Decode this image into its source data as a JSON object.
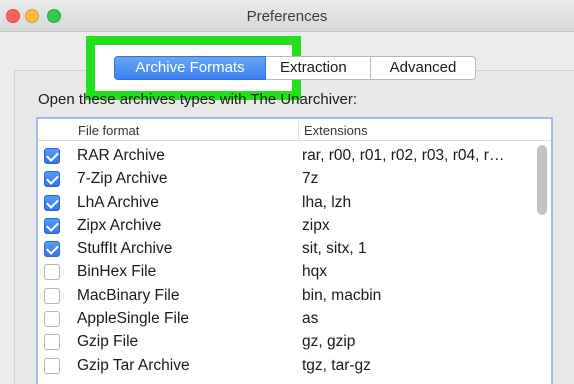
{
  "window": {
    "title": "Preferences"
  },
  "tabs": [
    {
      "label": "Archive Formats",
      "active": true
    },
    {
      "label": "Extraction",
      "active": false
    },
    {
      "label": "Advanced",
      "active": false
    }
  ],
  "instructions": "Open these archives types with The Unarchiver:",
  "table": {
    "headers": {
      "format": "File format",
      "extensions": "Extensions"
    },
    "rows": [
      {
        "checked": true,
        "format": "RAR Archive",
        "extensions": "rar, r00, r01, r02, r03, r04, r…"
      },
      {
        "checked": true,
        "format": "7-Zip Archive",
        "extensions": "7z"
      },
      {
        "checked": true,
        "format": "LhA Archive",
        "extensions": "lha, lzh"
      },
      {
        "checked": true,
        "format": "Zipx Archive",
        "extensions": "zipx"
      },
      {
        "checked": true,
        "format": "StuffIt Archive",
        "extensions": "sit, sitx, 1"
      },
      {
        "checked": false,
        "format": "BinHex File",
        "extensions": "hqx"
      },
      {
        "checked": false,
        "format": "MacBinary File",
        "extensions": "bin, macbin"
      },
      {
        "checked": false,
        "format": "AppleSingle File",
        "extensions": "as"
      },
      {
        "checked": false,
        "format": "Gzip File",
        "extensions": "gz, gzip"
      },
      {
        "checked": false,
        "format": "Gzip Tar Archive",
        "extensions": "tgz, tar-gz"
      }
    ]
  },
  "colors": {
    "highlight": "#22e01c",
    "accent": "#3b80f0"
  }
}
